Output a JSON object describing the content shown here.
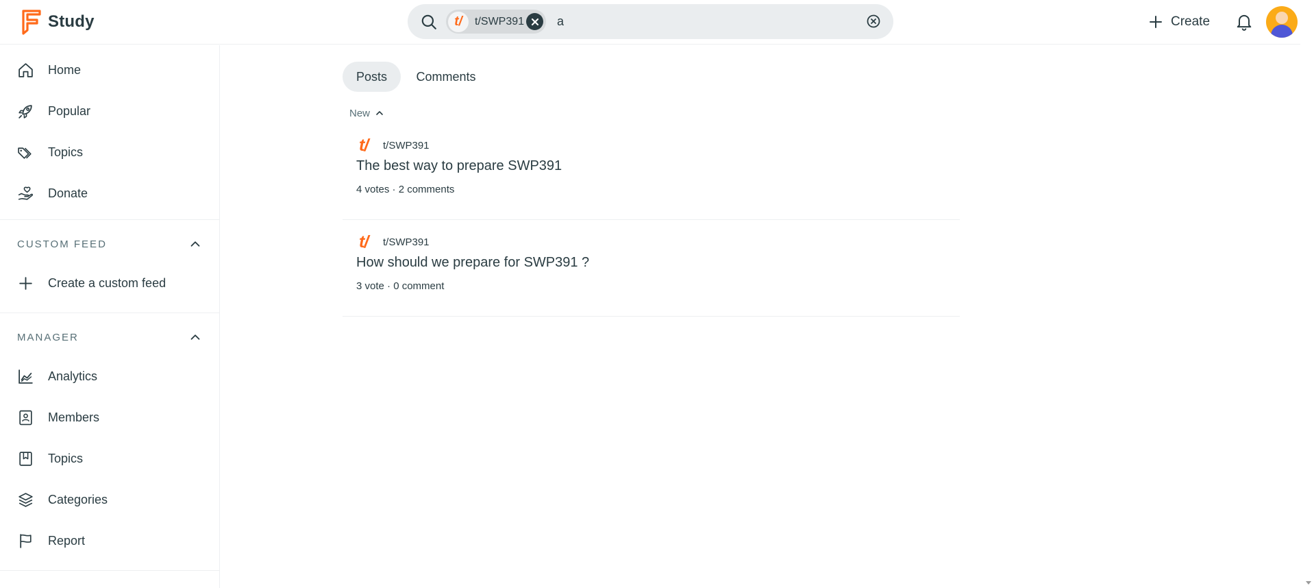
{
  "app": {
    "name": "Study"
  },
  "search": {
    "chip_label": "t/SWP391",
    "chip_logo": "t/",
    "query": "a"
  },
  "header": {
    "create_label": "Create"
  },
  "sidebar": {
    "items": [
      {
        "label": "Home",
        "icon": "home-icon"
      },
      {
        "label": "Popular",
        "icon": "rocket-icon"
      },
      {
        "label": "Topics",
        "icon": "tags-icon"
      },
      {
        "label": "Donate",
        "icon": "hand-heart-icon"
      }
    ],
    "custom_feed": {
      "title": "CUSTOM FEED",
      "items": [
        {
          "label": "Create a custom feed",
          "icon": "plus-icon"
        }
      ]
    },
    "manager": {
      "title": "MANAGER",
      "items": [
        {
          "label": "Analytics",
          "icon": "chart-icon"
        },
        {
          "label": "Members",
          "icon": "contact-book-icon"
        },
        {
          "label": "Topics",
          "icon": "bookmark-icon"
        },
        {
          "label": "Categories",
          "icon": "layers-icon"
        },
        {
          "label": "Report",
          "icon": "flag-icon"
        }
      ]
    }
  },
  "main": {
    "tabs": [
      {
        "label": "Posts",
        "active": true
      },
      {
        "label": "Comments",
        "active": false
      }
    ],
    "sort_label": "New",
    "posts": [
      {
        "community_logo": "t/",
        "community": "t/SWP391",
        "title": "The best way to prepare SWP391",
        "meta": "4 votes · 2 comments"
      },
      {
        "community_logo": "t/",
        "community": "t/SWP391",
        "title": "How should we prepare for SWP391 ?",
        "meta": "3 vote · 0 comment"
      }
    ]
  },
  "colors": {
    "accent": "#ff6a1a",
    "text": "#2a3c42",
    "muted": "#576f76",
    "search_bg": "#eaedef"
  }
}
